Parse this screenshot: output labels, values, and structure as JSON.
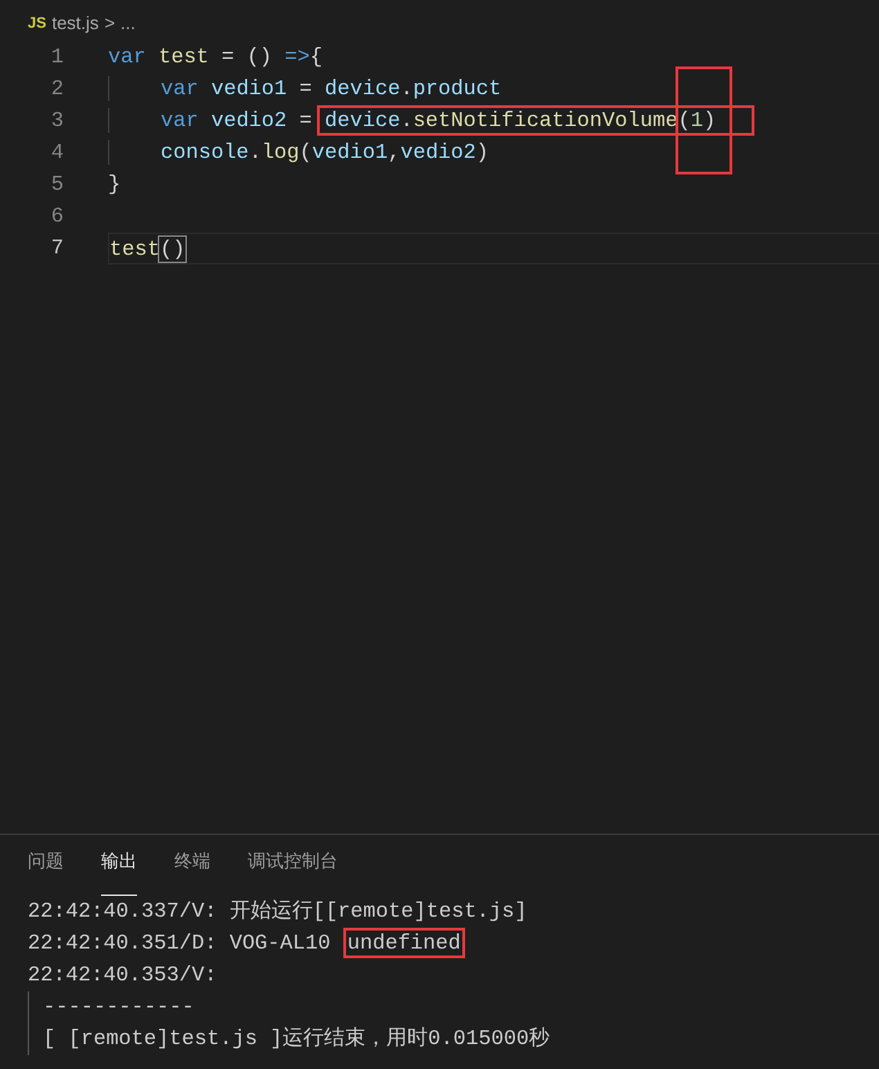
{
  "breadcrumb": {
    "file_icon": "JS",
    "file": "test.js",
    "separator": ">",
    "more": "..."
  },
  "editor": {
    "lines": [
      {
        "number": "1",
        "current": false,
        "indented": false,
        "tokens": [
          {
            "kind": "keyword",
            "text": "var "
          },
          {
            "kind": "function",
            "text": "test"
          },
          {
            "kind": "plain",
            "text": " = () "
          },
          {
            "kind": "keyword",
            "text": "=>"
          },
          {
            "kind": "plain",
            "text": "{"
          }
        ]
      },
      {
        "number": "2",
        "current": false,
        "indented": true,
        "tokens": [
          {
            "kind": "keyword",
            "text": "var "
          },
          {
            "kind": "variable",
            "text": "vedio1"
          },
          {
            "kind": "plain",
            "text": " = "
          },
          {
            "kind": "variable",
            "text": "device"
          },
          {
            "kind": "plain",
            "text": "."
          },
          {
            "kind": "variable",
            "text": "product"
          }
        ]
      },
      {
        "number": "3",
        "current": false,
        "indented": true,
        "tokens": [
          {
            "kind": "keyword",
            "text": "var "
          },
          {
            "kind": "variable",
            "text": "vedio2"
          },
          {
            "kind": "plain",
            "text": " = "
          },
          {
            "kind": "annotation",
            "tokens": [
              {
                "kind": "variable",
                "text": "device"
              },
              {
                "kind": "plain",
                "text": "."
              },
              {
                "kind": "function",
                "text": "setNotificationVolume"
              },
              {
                "kind": "annotation-tall",
                "tokens": [
                  {
                    "kind": "plain",
                    "text": "("
                  },
                  {
                    "kind": "number",
                    "text": "1"
                  },
                  {
                    "kind": "plain",
                    "text": ")"
                  }
                ]
              }
            ]
          }
        ]
      },
      {
        "number": "4",
        "current": false,
        "indented": true,
        "tokens": [
          {
            "kind": "variable",
            "text": "console"
          },
          {
            "kind": "plain",
            "text": "."
          },
          {
            "kind": "function",
            "text": "log"
          },
          {
            "kind": "plain",
            "text": "("
          },
          {
            "kind": "variable",
            "text": "vedio1"
          },
          {
            "kind": "plain",
            "text": ","
          },
          {
            "kind": "variable",
            "text": "vedio2"
          },
          {
            "kind": "plain",
            "text": ")"
          }
        ]
      },
      {
        "number": "5",
        "current": false,
        "indented": false,
        "tokens": [
          {
            "kind": "plain",
            "text": "}"
          }
        ]
      },
      {
        "number": "6",
        "current": false
      },
      {
        "number": "7",
        "current": true,
        "indented": false,
        "tokens": [
          {
            "kind": "function",
            "text": "test"
          },
          {
            "kind": "bracket-match",
            "text": "()"
          }
        ]
      }
    ]
  },
  "panel": {
    "tabs": [
      {
        "label": "问题",
        "selected": false
      },
      {
        "label": "输出",
        "selected": true
      },
      {
        "label": "终端",
        "selected": false
      },
      {
        "label": "调试控制台",
        "selected": false
      }
    ],
    "output": [
      {
        "grouped": false,
        "segments": [
          {
            "text": "22:42:40.337/V: 开始运行[[remote]test.js]",
            "boxed": false
          }
        ]
      },
      {
        "grouped": false,
        "segments": [
          {
            "text": "22:42:40.351/D: VOG-AL10 ",
            "boxed": false
          },
          {
            "text": "undefined",
            "boxed": true
          }
        ]
      },
      {
        "grouped": false,
        "segments": [
          {
            "text": "22:42:40.353/V:",
            "boxed": false
          }
        ]
      },
      {
        "grouped": true,
        "segments": [
          {
            "text": "------------",
            "boxed": false
          }
        ]
      },
      {
        "grouped": true,
        "segments": [
          {
            "text": "[ [remote]test.js ]运行结束，用时0.015000秒",
            "boxed": false
          }
        ]
      }
    ]
  }
}
